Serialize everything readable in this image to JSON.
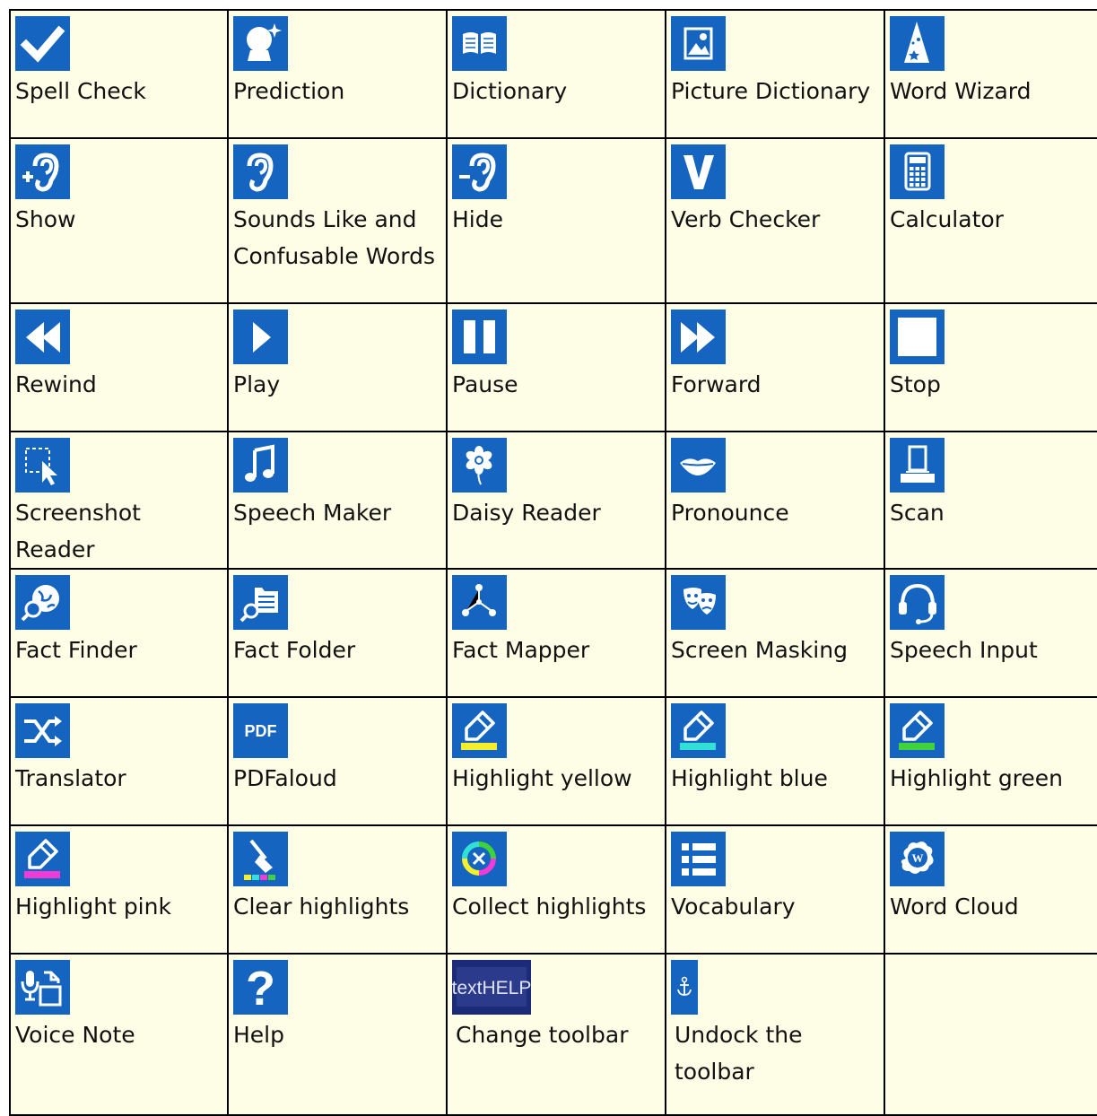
{
  "colors": {
    "icon_bg": "#1565c0",
    "cell_bg": "#fefde6",
    "border": "#000000",
    "label_text": "#111111"
  },
  "rows": [
    [
      {
        "label": "Spell Check",
        "icon": "checkmark-icon"
      },
      {
        "label": "Prediction",
        "icon": "crystal-ball-icon"
      },
      {
        "label": "Dictionary",
        "icon": "open-book-icon"
      },
      {
        "label": "Picture Dictionary",
        "icon": "picture-icon"
      },
      {
        "label": "Word Wizard",
        "icon": "wizard-hat-icon"
      }
    ],
    [
      {
        "label": "Show",
        "icon": "ear-plus-icon"
      },
      {
        "label": "Sounds Like and Confusable Words",
        "icon": "ear-icon"
      },
      {
        "label": "Hide",
        "icon": "ear-minus-icon"
      },
      {
        "label": "Verb Checker",
        "icon": "letter-v-icon"
      },
      {
        "label": "Calculator",
        "icon": "calculator-icon"
      }
    ],
    [
      {
        "label": "Rewind",
        "icon": "rewind-icon"
      },
      {
        "label": "Play",
        "icon": "play-icon"
      },
      {
        "label": "Pause",
        "icon": "pause-icon"
      },
      {
        "label": "Forward",
        "icon": "fast-forward-icon"
      },
      {
        "label": "Stop",
        "icon": "stop-icon"
      }
    ],
    [
      {
        "label": "Screenshot Reader",
        "icon": "screen-selection-icon"
      },
      {
        "label": "Speech Maker",
        "icon": "music-note-icon"
      },
      {
        "label": "Daisy Reader",
        "icon": "daisy-flower-icon"
      },
      {
        "label": "Pronounce",
        "icon": "lips-icon"
      },
      {
        "label": "Scan",
        "icon": "scanner-icon"
      }
    ],
    [
      {
        "label": "Fact Finder",
        "icon": "globe-search-icon"
      },
      {
        "label": "Fact Folder",
        "icon": "folder-search-icon"
      },
      {
        "label": "Fact Mapper",
        "icon": "node-map-icon"
      },
      {
        "label": "Screen Masking",
        "icon": "theatre-masks-icon"
      },
      {
        "label": "Speech Input",
        "icon": "headset-icon"
      }
    ],
    [
      {
        "label": "Translator",
        "icon": "shuffle-arrows-icon"
      },
      {
        "label": "PDFaloud",
        "icon": "pdf-icon",
        "icon_text": "PDF"
      },
      {
        "label": "Highlight yellow",
        "icon": "highlighter-yellow-icon",
        "accent": "#f5ef2b"
      },
      {
        "label": "Highlight blue",
        "icon": "highlighter-blue-icon",
        "accent": "#33e0d6"
      },
      {
        "label": "Highlight green",
        "icon": "highlighter-green-icon",
        "accent": "#3fd23a"
      }
    ],
    [
      {
        "label": "Highlight pink",
        "icon": "highlighter-pink-icon",
        "accent": "#f23ad6"
      },
      {
        "label": "Clear highlights",
        "icon": "broom-icon"
      },
      {
        "label": "Collect highlights",
        "icon": "color-cycle-icon"
      },
      {
        "label": "Vocabulary",
        "icon": "bulleted-list-icon"
      },
      {
        "label": "Word Cloud",
        "icon": "word-cloud-icon",
        "icon_text": "W"
      }
    ],
    [
      {
        "label": "Voice Note",
        "icon": "voice-note-icon"
      },
      {
        "label": "Help",
        "icon": "question-mark-icon",
        "icon_text": "?"
      },
      {
        "label": "Change toolbar",
        "icon": "texthelp-logo-icon",
        "icon_text": "textHELP"
      },
      {
        "label": "Undock the toolbar",
        "icon": "anchor-icon"
      },
      null
    ]
  ]
}
